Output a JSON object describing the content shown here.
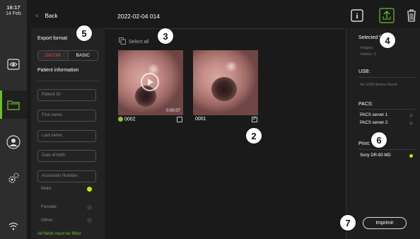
{
  "clock": {
    "time": "16:17",
    "date": "14 Feb"
  },
  "back_label": "Back",
  "export": {
    "heading": "Export format",
    "formats": [
      "DICOM",
      "BASIC"
    ],
    "patient_info_heading": "Patient information",
    "fields": [
      {
        "placeholder": "Patient ID:"
      },
      {
        "placeholder": "First name:"
      },
      {
        "placeholder": "Last name:"
      },
      {
        "placeholder": "Date of birth:"
      },
      {
        "placeholder": "Accession Number:"
      }
    ],
    "genders": [
      {
        "label": "Male:",
        "selected": true
      },
      {
        "label": "Female:",
        "selected": false
      },
      {
        "label": "Other:",
        "selected": false
      }
    ],
    "note": "All fields must be filled"
  },
  "folder_title": "2022-02-04 014",
  "select_all": "Select all",
  "thumbnails": [
    {
      "label": "0002",
      "duration": "0:00:07",
      "checked": false,
      "has_video": true
    },
    {
      "label": "0001",
      "duration": "",
      "checked": true,
      "has_video": false
    }
  ],
  "right_panel": {
    "selected_files": "Selected files",
    "images": "Images:",
    "videos": "Videos: 0",
    "usb_heading": "USB:",
    "usb_status": "No USB device found",
    "pacs_heading": "PACS:",
    "pacs_servers": [
      {
        "name": "PACS server 1",
        "active": false
      },
      {
        "name": "PACS server 2",
        "active": false
      }
    ],
    "print_heading": "Print:",
    "printers": [
      {
        "name": "Sony DR-80 MD",
        "active": true
      }
    ]
  },
  "print_button": "Imprimir",
  "callouts": [
    "5",
    "3",
    "4",
    "2",
    "6",
    "7"
  ],
  "colors": {
    "accent_green": "#6bbf2a",
    "selected_dot": "#c8e400",
    "active_format": "#e24a2e"
  }
}
